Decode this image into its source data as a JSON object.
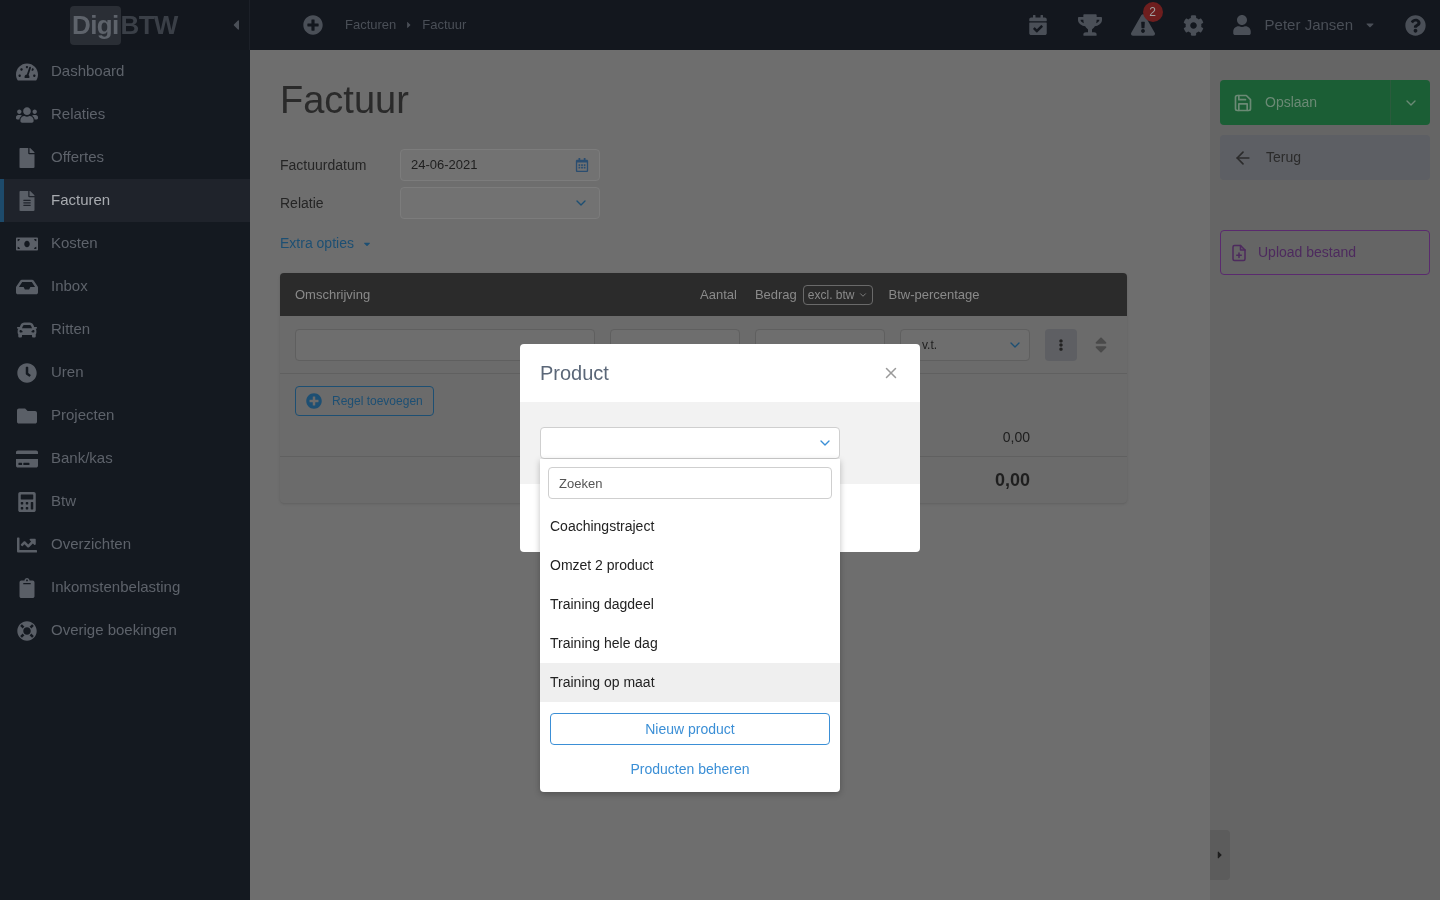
{
  "topbar": {
    "logo": {
      "part_1": "Digi",
      "part_2": "BTW"
    },
    "breadcrumb": [
      "Facturen",
      "Factuur"
    ],
    "alerts_badge": "2",
    "user_name": "Peter Jansen"
  },
  "sidebar": {
    "items": [
      {
        "label": "Dashboard",
        "selected": false
      },
      {
        "label": "Relaties",
        "selected": false
      },
      {
        "label": "Offertes",
        "selected": false
      },
      {
        "label": "Facturen",
        "selected": true
      },
      {
        "label": "Kosten",
        "selected": false
      },
      {
        "label": "Inbox",
        "selected": false
      },
      {
        "label": "Ritten",
        "selected": false
      },
      {
        "label": "Uren",
        "selected": false
      },
      {
        "label": "Projecten",
        "selected": false
      },
      {
        "label": "Bank/kas",
        "selected": false
      },
      {
        "label": "Btw",
        "selected": false
      },
      {
        "label": "Overzichten",
        "selected": false
      },
      {
        "label": "Inkomstenbelasting",
        "selected": false
      },
      {
        "label": "Overige boekingen",
        "selected": false
      }
    ]
  },
  "page": {
    "title": "Factuur",
    "fields": [
      {
        "label": "Factuurdatum",
        "kind": "date",
        "value": "24-06-2021"
      },
      {
        "label": "Relatie",
        "kind": "select"
      }
    ],
    "extra_options": "Extra opties"
  },
  "table": {
    "columns": {
      "description": "Omschrijving",
      "quantity": "Aantal",
      "amount": "Bedrag",
      "amount_mode": "excl. btw",
      "vat": "Btw-percentage"
    },
    "row": {
      "vat_value": "v.t."
    },
    "add_line": "Regel toevoegen",
    "subtotal": "0,00",
    "total": "0,00"
  },
  "actions": {
    "save": "Opslaan",
    "back": "Terug",
    "upload": "Upload bestand"
  },
  "modal": {
    "title": "Product",
    "search_placeholder": "Zoeken",
    "options": [
      {
        "label": "Coachingstraject",
        "selected": false
      },
      {
        "label": "Omzet 2 product",
        "selected": false
      },
      {
        "label": "Training dagdeel",
        "selected": false
      },
      {
        "label": "Training hele dag",
        "selected": false
      },
      {
        "label": "Training op maat",
        "selected": true
      }
    ],
    "new_product": "Nieuw product",
    "manage_products": "Producten beheren"
  }
}
